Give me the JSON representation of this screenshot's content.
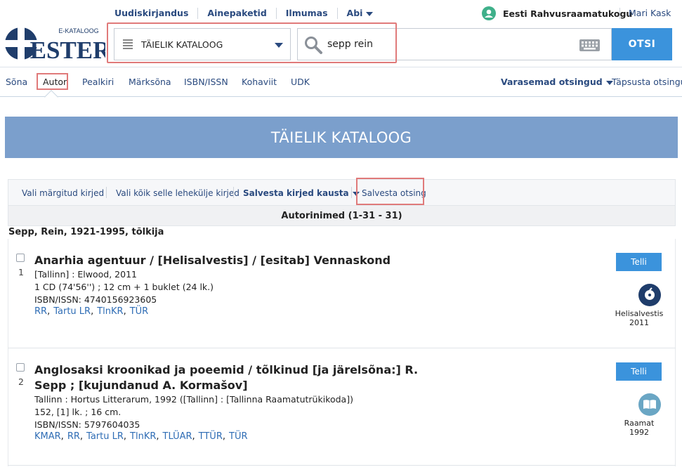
{
  "header": {
    "logo_small": "E-KATALOOG",
    "logo_big": "ESTER",
    "links": [
      "Uudiskirjandus",
      "Ainepaketid",
      "Ilmumas",
      "Abi"
    ],
    "library": "Eesti Rahvusraamatukogu",
    "user": "Mari Kask"
  },
  "search": {
    "catalog": "TÄIELIK KATALOOG",
    "query": "sepp rein",
    "button": "OTSI"
  },
  "tabs": {
    "items": [
      "Sõna",
      "Autor",
      "Pealkiri",
      "Märksõna",
      "ISBN/ISSN",
      "Kohaviit",
      "UDK"
    ],
    "active": "Autor",
    "previous": "Varasemad otsingud",
    "refine": "Täpsusta otsingut"
  },
  "banner": "TÄIELIK KATALOOG",
  "actions": {
    "select_marked": "Vali märgitud kirjed",
    "select_page": "Vali kõik selle lehekülje kirjed",
    "save_records": "Salvesta kirjed kausta",
    "save_search": "Salvesta otsing"
  },
  "results": {
    "header": "Autorinimed (1-31 - 31)",
    "author": "Sepp, Rein, 1921-1995, tõlkija",
    "records": [
      {
        "num": "1",
        "title": "Anarhia agentuur / [Helisalvestis] / [esitab] Vennaskond",
        "lines": [
          "[Tallinn] : Elwood, 2011",
          "1 CD (74'56'') ; 12 cm + 1 buklet (24 lk.)",
          "ISBN/ISSN:  4740156923605"
        ],
        "holdings": [
          "RR",
          "Tartu LR",
          "TlnKR",
          "TÜR"
        ],
        "order": "Telli",
        "type": "Helisalvestis",
        "year": "2011"
      },
      {
        "num": "2",
        "title": "Anglosaksi kroonikad ja poeemid / tõlkinud [ja järelsõna:] R. Sepp ; [kujundanud A. Kormašov]",
        "lines": [
          "Tallinn : Hortus Litterarum, 1992 ([Tallinn] : [Tallinna Raamatutrükikoda])",
          "152, [1] lk. ; 16 cm.",
          "ISBN/ISSN:  5797604035"
        ],
        "holdings": [
          "KMAR",
          "RR",
          "Tartu LR",
          "TlnKR",
          "TLÜAR",
          "TTÜR",
          "TÜR"
        ],
        "order": "Telli",
        "type": "Raamat",
        "year": "1992"
      }
    ]
  },
  "colors": {
    "link": "#2a4a7f",
    "accent": "#3b93dc",
    "banner": "#7b9fcc",
    "highlight": "#e07a7a",
    "music_icon": "#1f3d6b",
    "book_icon": "#6aa6c4"
  }
}
